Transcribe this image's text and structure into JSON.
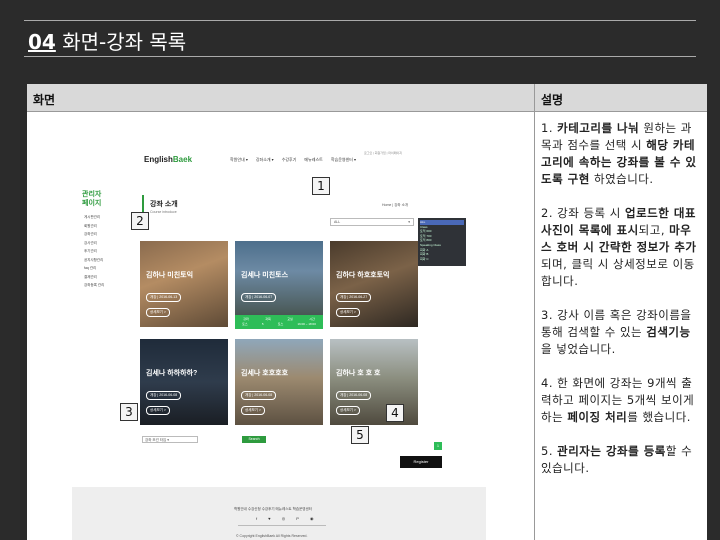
{
  "slide": {
    "num": "04",
    "title": "화면-강좌 목록"
  },
  "table": {
    "header_left": "화면",
    "header_right": "설명"
  },
  "site": {
    "logo_main": "English",
    "logo_accent": "Baek",
    "gnb": [
      "학원안내 ▾",
      "강좌소개 ▾",
      "수강후기",
      "메뉴레스트",
      "학습운영센터 ▾"
    ],
    "util": "로그인 | 회원가입 | 마이페이지",
    "side_title_1": "관리자",
    "side_title_2": "페이지",
    "side_menu": [
      "게시판관리",
      "회원관리",
      "강좌관리",
      "강사관리",
      "후기관리",
      "공지사항관리",
      "faq 관리",
      "결제관리",
      "강좌등록 관리"
    ],
    "page_title": "강좌 소개",
    "page_subtitle": "Course introduce",
    "breadcrumb": "Home | 강좌 소개",
    "select_value": "ALL",
    "dropdown_items": [
      "ALL",
      "Class",
      "토익 600",
      "토익 700",
      "토익 800",
      "Speaking Class",
      "회화 A",
      "회화 B",
      "회화 C"
    ],
    "cards": [
      {
        "title": "김하나 미친토익",
        "date": "개강 | 2016-06-13",
        "more": "상세보기 >"
      },
      {
        "title": "김세나 미친토스",
        "date": "개강 | 2016-06-07",
        "more": ""
      },
      {
        "title": "김하다 하호호토익",
        "date": "개강 | 2016-06-27",
        "more": "상세보기 >"
      },
      {
        "title": "김세나 하하하하?",
        "date": "개강 | 2016-06-08",
        "more": "상세보기 >"
      },
      {
        "title": "김세나 호호호호",
        "date": "개강 | 2016-06-08",
        "more": "상세보기 >"
      },
      {
        "title": "김하나 호 호 호",
        "date": "개강 | 2016-06-08",
        "more": "상세보기 >"
      }
    ],
    "hover_info": {
      "headers": [
        "강좌",
        "과목",
        "교실",
        "시간"
      ],
      "values": [
        "토스",
        "5",
        "토스",
        "16:00 ~ 18:00"
      ]
    },
    "search_placeholder": "강좌 조건 타입",
    "search_button": "Search",
    "pager": "1",
    "register_button": "Register",
    "footer_links": "학원안내 수강신청 수강후기 메뉴레스트 학습운영센터",
    "footer_social": "f ♥ ◎ P ◉",
    "footer_copy": "© Copyright EnglishBaek All Rights Reserved."
  },
  "badges": [
    "1",
    "2",
    "3",
    "4",
    "5"
  ]
}
